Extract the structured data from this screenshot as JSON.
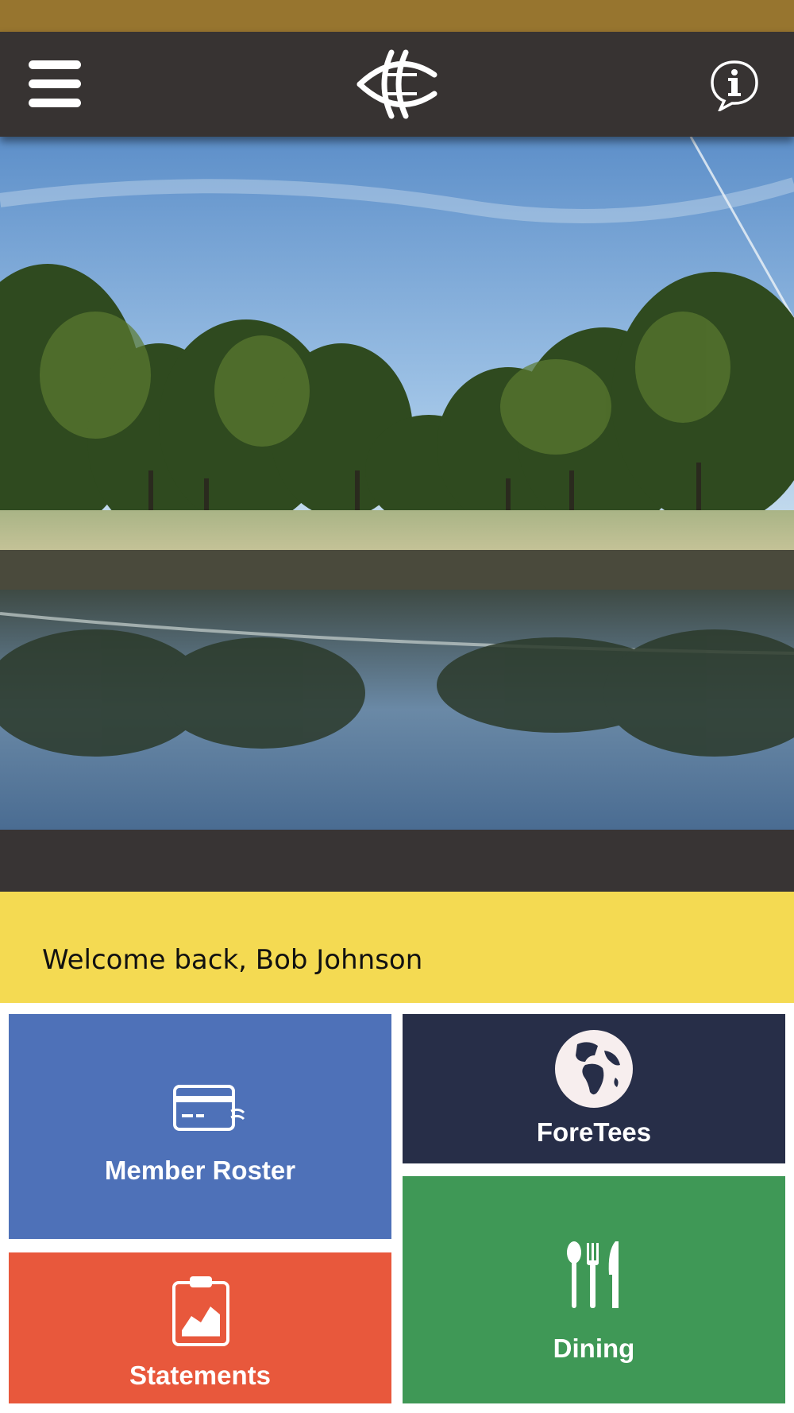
{
  "header": {
    "menu_icon": "hamburger-menu-icon",
    "logo_icon": "club-crest-logo",
    "info_icon": "info-speech-bubble-icon",
    "colors": {
      "status_strip": "#97752f",
      "appbar": "#373332"
    }
  },
  "hero": {
    "image": "golf course with trees and pond reflection at sunrise"
  },
  "welcome": {
    "text": "Welcome back, Bob Johnson",
    "background": "#f4da52"
  },
  "tiles": [
    {
      "label": "Member Roster",
      "icon": "id-card-icon",
      "color": "#4e71b8"
    },
    {
      "label": "ForeTees",
      "icon": "globe-icon",
      "color": "#272e48"
    },
    {
      "label": "Statements",
      "icon": "clipboard-chart-icon",
      "color": "#e8583c"
    },
    {
      "label": "Dining",
      "icon": "utensils-icon",
      "color": "#3f9856"
    }
  ]
}
